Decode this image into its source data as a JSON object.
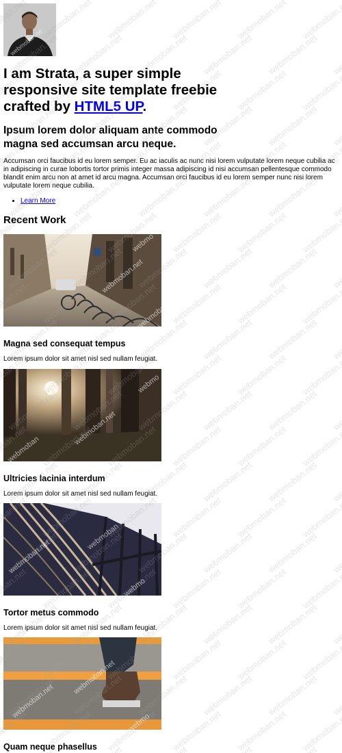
{
  "header": {
    "headline_prefix": "I am Strata, a super simple responsive site template freebie crafted by ",
    "headline_link": "HTML5 UP",
    "headline_suffix": "."
  },
  "intro": {
    "subheading": "Ipsum lorem dolor aliquam ante commodo magna sed accumsan arcu neque.",
    "paragraph": "Accumsan orci faucibus id eu lorem semper. Eu ac iaculis ac nunc nisi lorem vulputate lorem neque cubilia ac in adipiscing in curae lobortis tortor primis integer massa adipiscing id nisi accumsan pellentesque commodo blandit enim arcu non at amet id arcu magna. Accumsan orci faucibus id eu lorem semper nunc nisi lorem vulputate lorem neque cubilia.",
    "learn_more": "Learn More"
  },
  "recent_work": {
    "title": "Recent Work",
    "items": [
      {
        "title": "Magna sed consequat tempus",
        "description": "Lorem ipsum dolor sit amet nisl sed nullam feugiat."
      },
      {
        "title": "Ultricies lacinia interdum",
        "description": "Lorem ipsum dolor sit amet nisl sed nullam feugiat."
      },
      {
        "title": "Tortor metus commodo",
        "description": "Lorem ipsum dolor sit amet nisl sed nullam feugiat."
      },
      {
        "title": "Quam neque phasellus",
        "description": ""
      }
    ]
  },
  "watermark": "webmoban.net"
}
